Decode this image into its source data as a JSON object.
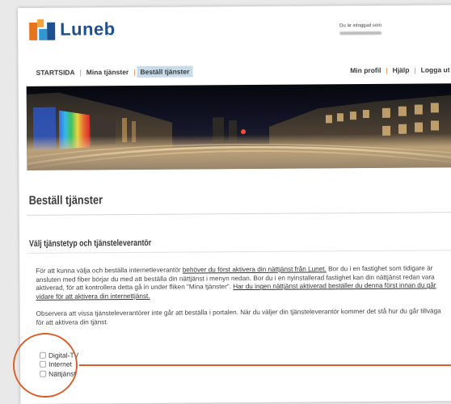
{
  "brand": {
    "name": "Luneb"
  },
  "header": {
    "login_text": "Du är inloggad som"
  },
  "nav": {
    "left": [
      "STARTSIDA",
      "Mina tjänster",
      "Beställ tjänster"
    ],
    "right": [
      "Min profil",
      "Hjälp",
      "Logga ut"
    ],
    "active": "Beställ tjänster"
  },
  "main": {
    "title": "Beställ tjänster",
    "section_heading": "Välj tjänstetyp och tjänsteleverantör",
    "para1_part1": "För att kunna välja och beställa internetleverantör ",
    "para1_link1": "behöver du först aktivera din nättjänst från Lunet.",
    "para1_part2": " Bor du i en fastighet som tidigare är ansluten med fiber börjar du med att beställa din nättjänst i menyn nedan. Bor du i en nyinstallerad fastighet kan din nättjänst redan vara aktiverad, för att kontrollera detta gå in under fliken \"Mina tjänster\". ",
    "para1_link2": "Har du ingen nättjänst aktiverad beställer du denna först innan du går vidare för att aktivera din internettjänst.",
    "para2": "Observera att vissa tjänsteleverantörer inte går att beställa i portalen. När du väljer din tjänsteleverantör kommer det stå hur du går tillväga för att aktivera din tjänst.",
    "options": [
      "Digital-TV",
      "Internet",
      "Nättjänst"
    ]
  },
  "annotation": {
    "color": "#d9602b"
  },
  "colors": {
    "brand_blue": "#1e4f8f",
    "brand_orange": "#e8731f",
    "nav_active_bg": "#c7dbe9"
  }
}
